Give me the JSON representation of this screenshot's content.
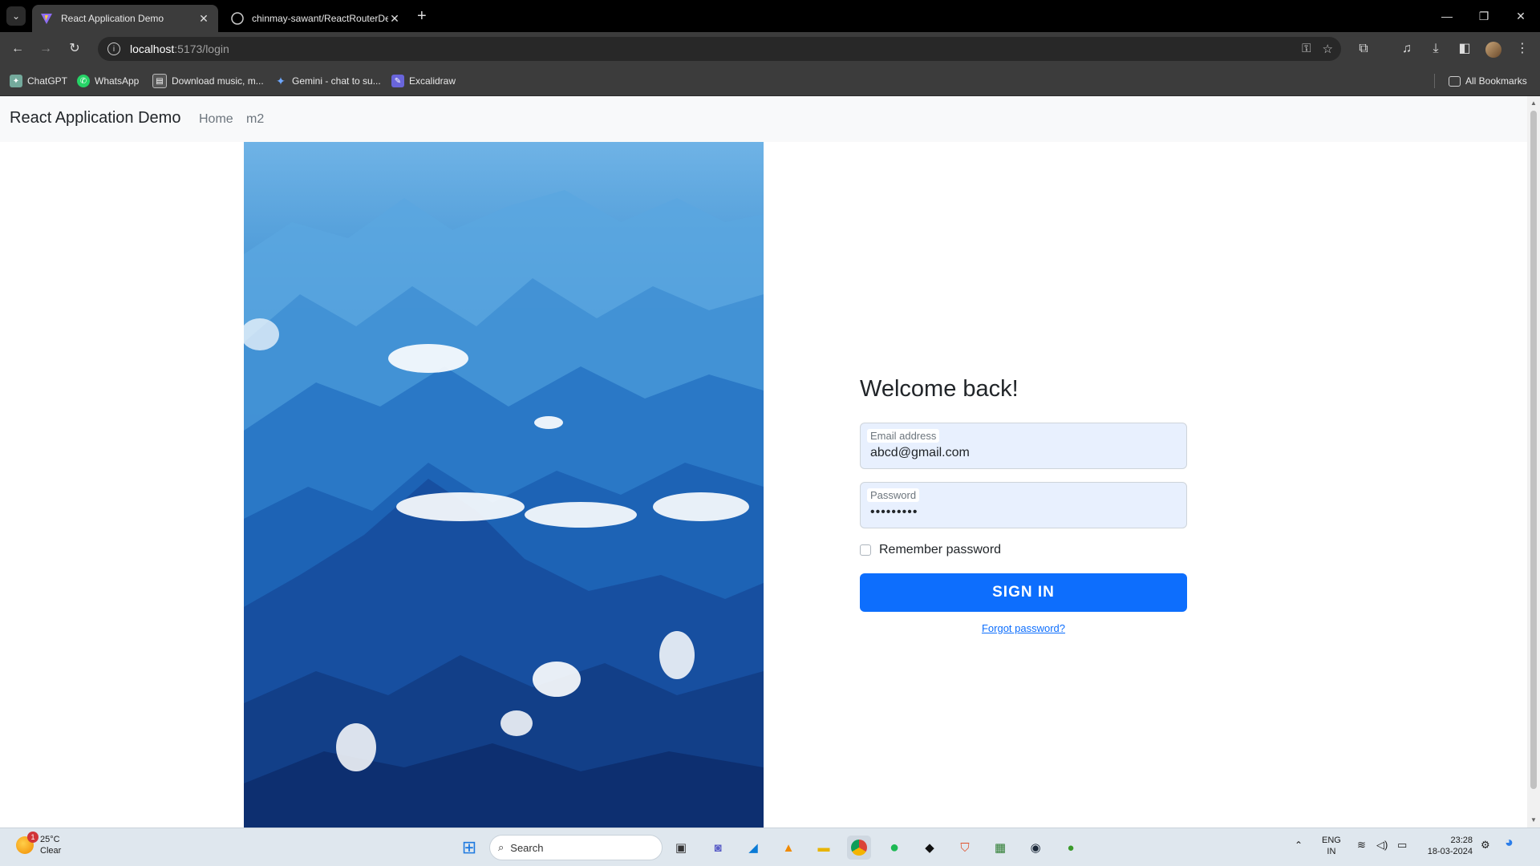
{
  "browser": {
    "tabs": [
      {
        "title": "React Application Demo",
        "active": true
      },
      {
        "title": "chinmay-sawant/ReactRouterDe",
        "active": false
      }
    ],
    "url_host": "localhost",
    "url_path": ":5173/login",
    "bookmarks": [
      {
        "label": "ChatGPT",
        "icon": "chatgpt-icon"
      },
      {
        "label": "WhatsApp",
        "icon": "whatsapp-icon"
      },
      {
        "label": "Download music, m...",
        "icon": "download-music-icon"
      },
      {
        "label": "Gemini - chat to su...",
        "icon": "gemini-icon"
      },
      {
        "label": "Excalidraw",
        "icon": "excalidraw-icon"
      }
    ],
    "all_bookmarks": "All Bookmarks"
  },
  "app": {
    "brand": "React Application Demo",
    "nav": [
      "Home",
      "m2"
    ]
  },
  "login": {
    "heading": "Welcome back!",
    "email_label": "Email address",
    "email_value": "abcd@gmail.com",
    "password_label": "Password",
    "password_value": "•••••••••",
    "remember_label": "Remember password",
    "signin_label": "SIGN IN",
    "forgot_label": "Forgot password?"
  },
  "taskbar": {
    "weather_temp": "25°C",
    "weather_desc": "Clear",
    "weather_badge": "1",
    "search_placeholder": "Search",
    "lang_top": "ENG",
    "lang_bottom": "IN",
    "time": "23:28",
    "date": "18-03-2024"
  },
  "colors": {
    "primary": "#0d6efd",
    "navbar_bg": "#f8f9fa",
    "input_bg": "#e8f0fe"
  }
}
